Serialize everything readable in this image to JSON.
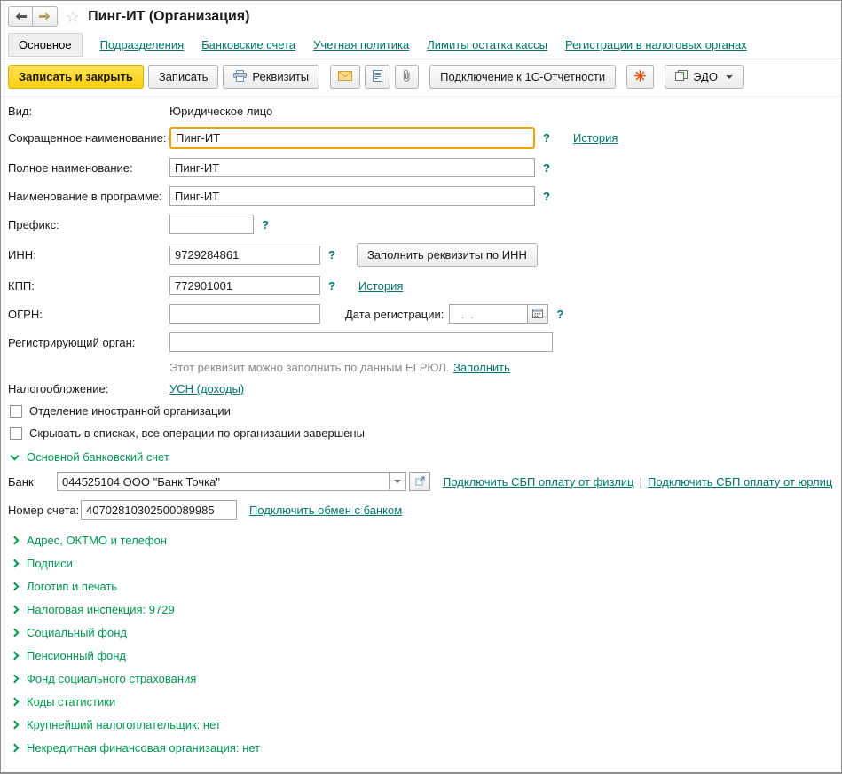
{
  "window": {
    "title": "Пинг-ИТ (Организация)"
  },
  "tabs": [
    {
      "label": "Основное"
    },
    {
      "label": "Подразделения"
    },
    {
      "label": "Банковские счета"
    },
    {
      "label": "Учетная политика"
    },
    {
      "label": "Лимиты остатка кассы"
    },
    {
      "label": "Регистрации в налоговых органах"
    }
  ],
  "toolbar": {
    "save_close": "Записать и закрыть",
    "save": "Записать",
    "requisites": "Реквизиты",
    "connect_reporting": "Подключение к 1С-Отчетности",
    "edo": "ЭДО"
  },
  "icons": {
    "help": "?"
  },
  "form": {
    "kind": {
      "label": "Вид:",
      "value": "Юридическое лицо"
    },
    "short_name": {
      "label": "Сокращенное наименование:",
      "value": "Пинг-ИТ",
      "history": "История"
    },
    "full_name": {
      "label": "Полное наименование:",
      "value": "Пинг-ИТ"
    },
    "app_name": {
      "label": "Наименование в программе:",
      "value": "Пинг-ИТ"
    },
    "prefix": {
      "label": "Префикс:",
      "value": ""
    },
    "inn": {
      "label": "ИНН:",
      "value": "9729284861",
      "fill_button": "Заполнить реквизиты по ИНН"
    },
    "kpp": {
      "label": "КПП:",
      "value": "772901001",
      "history": "История"
    },
    "ogrn": {
      "label": "ОГРН:",
      "value": ""
    },
    "reg_date": {
      "label": "Дата регистрации:",
      "value": "  .  ."
    },
    "reg_authority": {
      "label": "Регистрирующий орган:",
      "value": ""
    },
    "egrul_hint": "Этот реквизит можно заполнить по данным ЕГРЮЛ.",
    "egrul_fill": "Заполнить",
    "taxation": {
      "label": "Налогообложение:",
      "value": "УСН (доходы)"
    },
    "checkbox_foreign": "Отделение иностранной организации",
    "checkbox_hide": "Скрывать в списках, все операции по организации завершены",
    "bank_section": {
      "title": "Основной банковский счет",
      "bank_label": "Банк:",
      "bank_value": "044525104 ООО \"Банк Точка\"",
      "sbp_individuals": "Подключить СБП оплату от физлиц",
      "separator": "|",
      "sbp_companies": "Подключить СБП оплату от юрлиц",
      "account_label": "Номер счета:",
      "account_value": "40702810302500089985",
      "bank_exchange": "Подключить обмен с банком"
    },
    "sections": [
      "Адрес, ОКТМО и телефон",
      "Подписи",
      "Логотип и печать",
      "Налоговая инспекция: 9729",
      "Социальный фонд",
      "Пенсионный фонд",
      "Фонд социального страхования",
      "Коды статистики",
      "Крупнейший налогоплательщик: нет",
      "Некредитная финансовая организация: нет"
    ]
  }
}
